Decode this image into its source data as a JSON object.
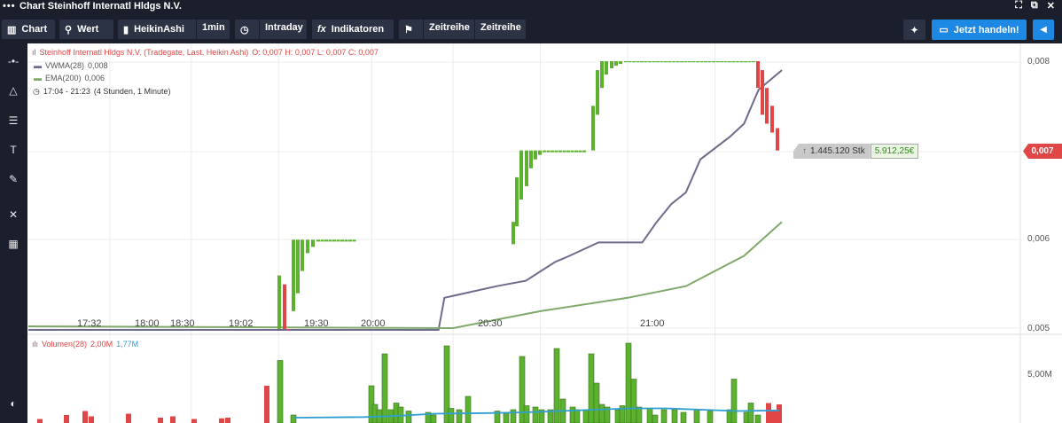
{
  "window": {
    "title": "Chart Steinhoff Internatl Hldgs N.V."
  },
  "toolbar": {
    "chart_label": "Chart",
    "wert_label": "Wert",
    "candle_type_label": "HeikinAshi",
    "interval_label": "1min",
    "range_label": "Intraday",
    "indicators_label": "Indikatoren",
    "zeitreihe1_label": "Zeitreihe",
    "zeitreihe2_label": "Zeitreihe",
    "trade_label": "Jetzt handeln!"
  },
  "legend": {
    "instrument": "Steinhoff Internatl Hldgs N.V. (Tradegate, Last, Heikin Ashi)",
    "ohlc": "O: 0,007  H: 0,007  L: 0,007  C: 0,007",
    "vwma": "VWMA(28)",
    "vwma_value": "0,008",
    "ema": "EMA(200)",
    "ema_value": "0,006",
    "timerange": "17:04 - 21:23",
    "timerange_detail": "(4 Stunden, 1 Minute)",
    "volume": "Volumen(28)",
    "volume_v1": "2,00M",
    "volume_v2": "1,77M"
  },
  "price_axis": [
    "0,008",
    "0,006",
    "0,005"
  ],
  "current_price": "0,007",
  "volume_axis": "5,00M",
  "time_axis": [
    "17:32",
    "18:00",
    "18:30",
    "19:02",
    "19:30",
    "20:00",
    "20:30",
    "21:00"
  ],
  "tooltip": {
    "shares": "1.445.120 Stk",
    "value": "5.912,25€"
  },
  "colors": {
    "up": "#5cb22e",
    "down": "#e04646",
    "vwma": "#6e6a8c",
    "ema": "#7fa86a",
    "vol_ma": "#2f9fd1",
    "accent": "#1e88e5"
  },
  "chart_data": {
    "type": "candlestick",
    "candle_type": "HeikinAshi",
    "price_ylim": [
      0.005,
      0.008
    ],
    "series": [
      {
        "name": "VWMA(28)",
        "points": [
          [
            "17:04",
            0.00499
          ],
          [
            "19:25",
            0.00499
          ],
          [
            "19:27",
            0.00535
          ],
          [
            "19:45",
            0.00548
          ],
          [
            "19:55",
            0.00554
          ],
          [
            "20:05",
            0.00575
          ],
          [
            "20:10",
            0.00582
          ],
          [
            "20:20",
            0.00597
          ],
          [
            "20:35",
            0.00597
          ],
          [
            "20:40",
            0.0062
          ],
          [
            "20:45",
            0.0064
          ],
          [
            "20:50",
            0.00653
          ],
          [
            "20:55",
            0.0069
          ],
          [
            "21:05",
            0.00715
          ],
          [
            "21:10",
            0.0073
          ],
          [
            "21:15",
            0.00768
          ],
          [
            "21:23",
            0.0079
          ]
        ]
      },
      {
        "name": "EMA(200)",
        "points": [
          [
            "17:04",
            0.00503
          ],
          [
            "19:30",
            0.00501
          ],
          [
            "20:00",
            0.0052
          ],
          [
            "20:30",
            0.00535
          ],
          [
            "20:50",
            0.00548
          ],
          [
            "21:10",
            0.00582
          ],
          [
            "21:23",
            0.0062
          ]
        ]
      }
    ],
    "volume_ylim": [
      0,
      6200000
    ],
    "volume_ma_name": "Volumen(28)"
  }
}
